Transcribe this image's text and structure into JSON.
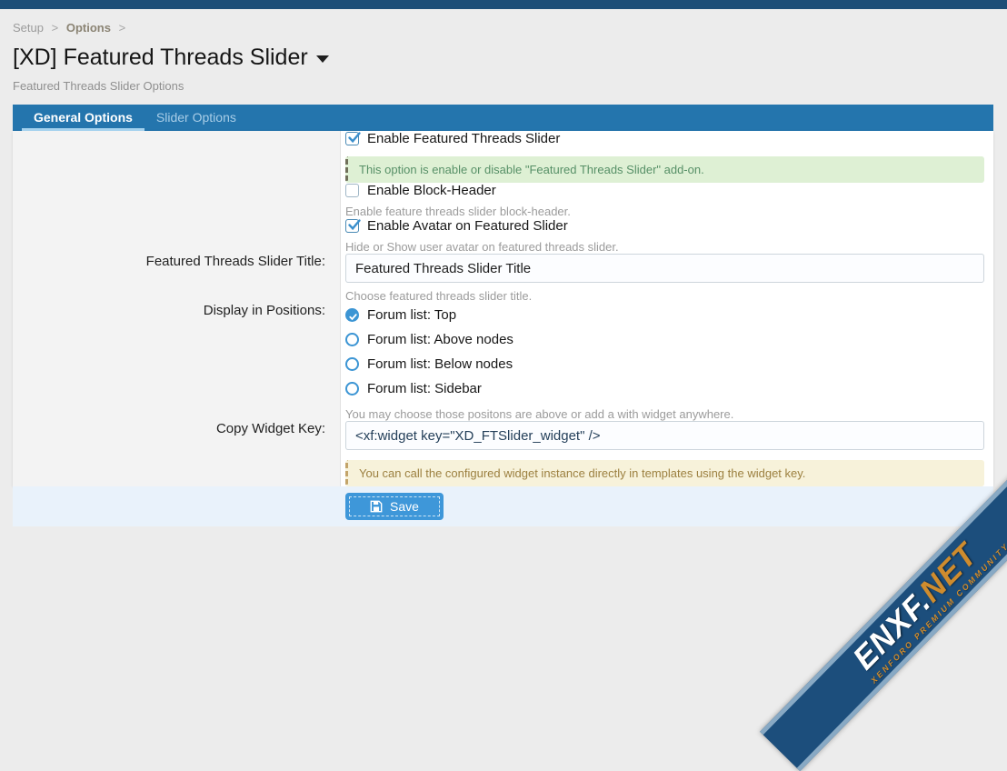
{
  "breadcrumb": {
    "items": [
      "Setup",
      "Options"
    ],
    "separator": ">"
  },
  "header": {
    "title": "[XD] Featured Threads Slider",
    "subtitle": "Featured Threads Slider Options"
  },
  "tabs": [
    {
      "label": "General Options",
      "active": true
    },
    {
      "label": "Slider Options",
      "active": false
    }
  ],
  "form": {
    "enable_slider": {
      "label": "Enable Featured Threads Slider",
      "checked": true,
      "message": "This option is enable or disable \"Featured Threads Slider\" add-on."
    },
    "enable_block_header": {
      "label": "Enable Block-Header",
      "checked": false,
      "hint": "Enable feature threads slider block-header."
    },
    "enable_avatar": {
      "label": "Enable Avatar on Featured Slider",
      "checked": true,
      "hint": "Hide or Show user avatar on featured threads slider."
    },
    "slider_title": {
      "label": "Featured Threads Slider Title:",
      "value": "Featured Threads Slider Title",
      "hint": "Choose featured threads slider title."
    },
    "positions": {
      "label": "Display in Positions:",
      "options": [
        {
          "label": "Forum list: Top",
          "selected": true
        },
        {
          "label": "Forum list: Above nodes",
          "selected": false
        },
        {
          "label": "Forum list: Below nodes",
          "selected": false
        },
        {
          "label": "Forum list: Sidebar",
          "selected": false
        }
      ],
      "hint": "You may choose those positons are above or add a with widget anywhere."
    },
    "widget_key": {
      "label": "Copy Widget Key:",
      "value": "<xf:widget key=\"XD_FTSlider_widget\" />",
      "message": "You can call the configured widget instance directly in templates using the widget key."
    }
  },
  "save_button": {
    "label": "Save"
  },
  "watermark": {
    "brand_primary": "ENXF.",
    "brand_secondary": "NET",
    "tagline": "XENFORO PREMIUM COMMUNITY"
  },
  "colors": {
    "topbar": "#1d4e77",
    "tabbar": "#2475ad",
    "accent_blue": "#3c95d4",
    "message_green_bg": "#def0d4",
    "message_yellow_bg": "#f7f2da",
    "save_bar_bg": "#e9f2fb",
    "page_bg": "#ececec"
  }
}
